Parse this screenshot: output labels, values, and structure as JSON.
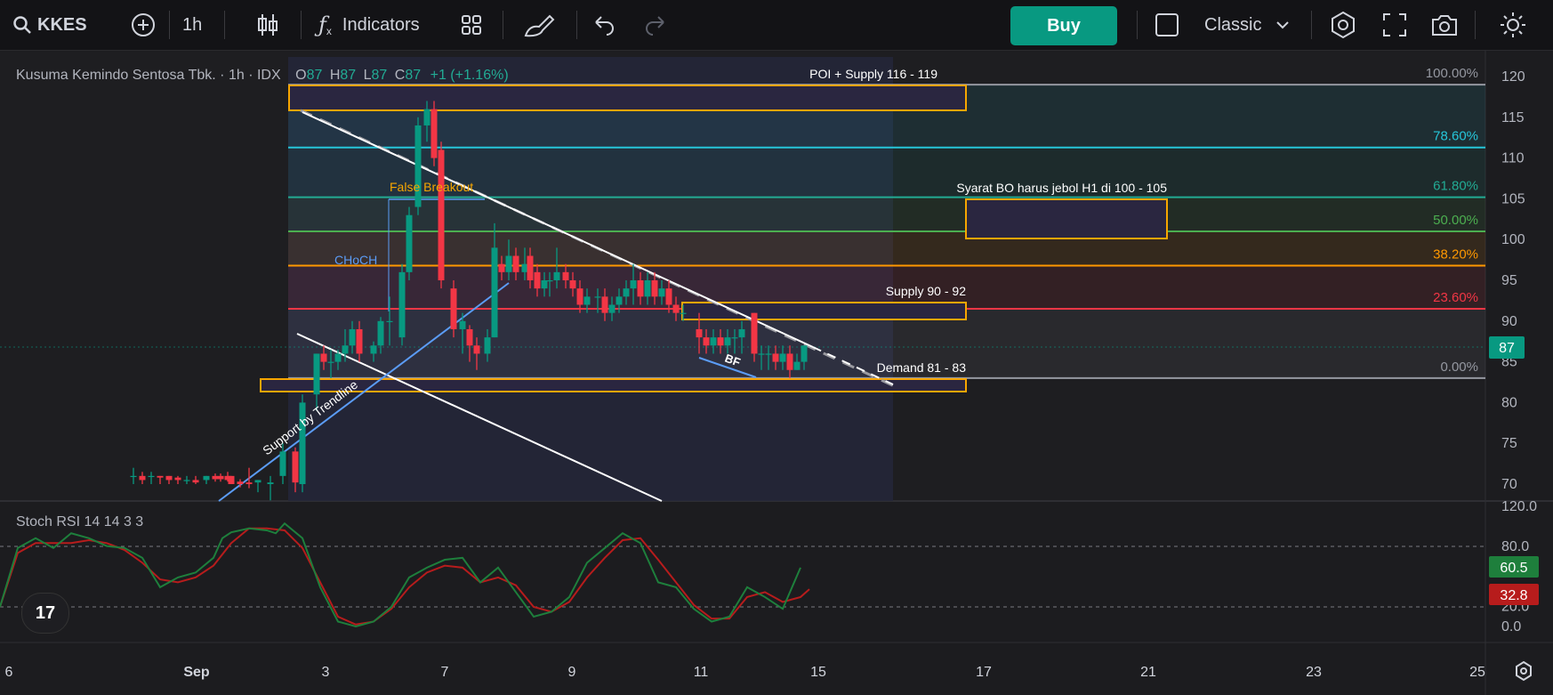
{
  "toolbar": {
    "symbol": "KKES",
    "interval": "1h",
    "indicators_label": "Indicators",
    "buy_label": "Buy",
    "layout_label": "Classic",
    "colors": {
      "buy": "#089981",
      "bg": "#131316"
    }
  },
  "legend": {
    "name": "Kusuma Kemindo Sentosa Tbk.",
    "interval": "1h",
    "exchange": "IDX",
    "o_label": "O",
    "o": "87",
    "h_label": "H",
    "h": "87",
    "l_label": "L",
    "l": "87",
    "c_label": "C",
    "c": "87",
    "change": "+1 (+1.16%)"
  },
  "annotations": {
    "poi_supply": "POI + Supply 116 - 119",
    "syarat_bo": "Syarat BO harus jebol H1 di 100 - 105",
    "supply": "Supply 90 - 92",
    "demand": "Demand 81 - 83",
    "false_breakout": "False Breakout",
    "choch": "CHoCH",
    "support_trendline": "Support by Trendline",
    "bf": "BF"
  },
  "fib": [
    {
      "label": "100.00%",
      "price": 119,
      "color": "#9598a1"
    },
    {
      "label": "78.60%",
      "price": 111.3,
      "color": "#26c6da"
    },
    {
      "label": "61.80%",
      "price": 105.2,
      "color": "#22ab94"
    },
    {
      "label": "50.00%",
      "price": 101,
      "color": "#4caf50"
    },
    {
      "label": "38.20%",
      "price": 96.8,
      "color": "#ff9800"
    },
    {
      "label": "23.60%",
      "price": 91.5,
      "color": "#f23645"
    },
    {
      "label": "0.00%",
      "price": 83,
      "color": "#9598a1"
    }
  ],
  "price_axis": {
    "ticks": [
      "120",
      "115",
      "110",
      "105",
      "100",
      "95",
      "90",
      "85",
      "80",
      "75",
      "70"
    ],
    "current": "87",
    "current_color": "#089981"
  },
  "rsi": {
    "title": "Stoch RSI 14 14 3 3",
    "axis_ticks": [
      "120.0",
      "80.0",
      "20.0",
      "0.0"
    ],
    "k_value": "60.5",
    "d_value": "32.8",
    "k_color": "#1e7f3c",
    "d_color": "#b71c1c"
  },
  "time_axis": {
    "ticks": [
      "6",
      "Sep",
      "3",
      "7",
      "9",
      "11",
      "15",
      "17",
      "21",
      "23",
      "25"
    ]
  },
  "tv_logo": "17"
}
